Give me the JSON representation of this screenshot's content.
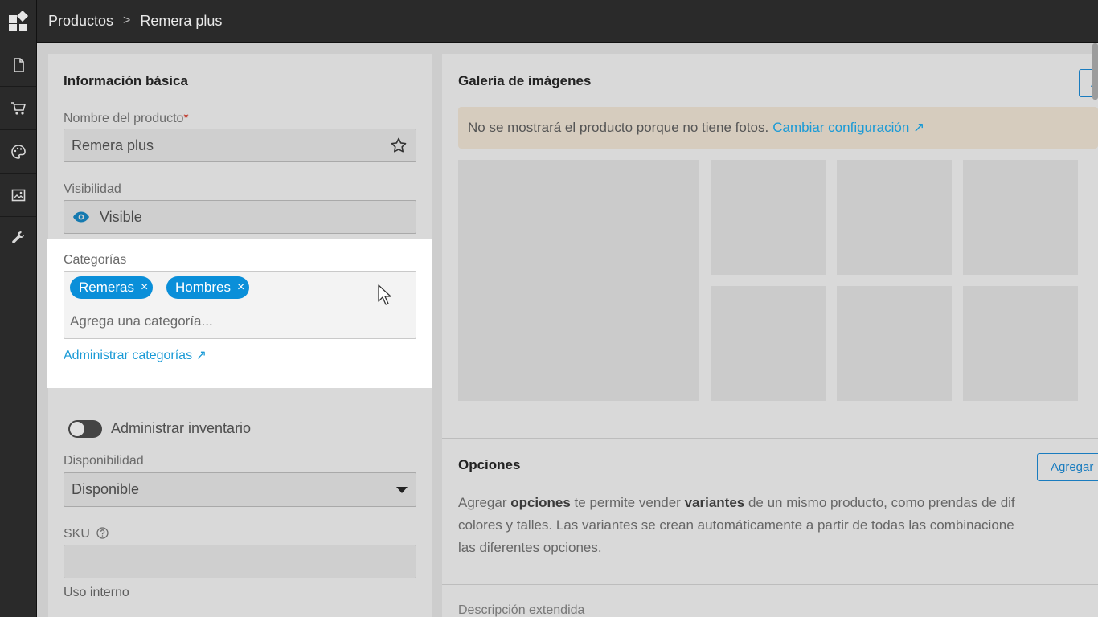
{
  "breadcrumb": {
    "parent": "Productos",
    "separator": ">",
    "current": "Remera plus"
  },
  "sidebar": {
    "icons": [
      "document-icon",
      "cart-icon",
      "palette-icon",
      "image-icon",
      "wrench-icon"
    ]
  },
  "basic_info": {
    "title": "Información básica",
    "name_label": "Nombre del producto",
    "required_mark": "*",
    "name_value": "Remera plus",
    "visibility_label": "Visibilidad",
    "visibility_value": "Visible",
    "categories_label": "Categorías",
    "categories": [
      {
        "label": "Remeras",
        "remove": "×"
      },
      {
        "label": "Hombres",
        "remove": "×"
      }
    ],
    "category_placeholder": "Agrega una categoría...",
    "manage_categories_link": "Administrar categorías ↗",
    "inventory_toggle_label": "Administrar inventario",
    "availability_label": "Disponibilidad",
    "availability_value": "Disponible",
    "sku_label": "SKU",
    "sku_value": "",
    "internal_use_label": "Uso interno"
  },
  "gallery": {
    "title": "Galería de imágenes",
    "add_button": "A",
    "notice_text": "No se mostrará el producto porque no tiene fotos. ",
    "notice_link": "Cambiar configuración ↗"
  },
  "options": {
    "title": "Opciones",
    "add_button": "Agregar",
    "description_line1_a": "Agregar ",
    "description_line1_b": "opciones",
    "description_line1_c": " te permite vender ",
    "description_line1_d": "variantes",
    "description_line1_e": " de un mismo producto, como prendas de dif",
    "description_line2": "colores y talles. Las variantes se crean automáticamente a partir de todas las combinacione",
    "description_line3": "las diferentes opciones."
  },
  "extended_description": {
    "label": "Descripción extendida"
  },
  "colors": {
    "accent": "#0a8fd9",
    "link": "#1a9ad6",
    "chrome": "#2a2a2a",
    "highlight": "#ffffff"
  }
}
